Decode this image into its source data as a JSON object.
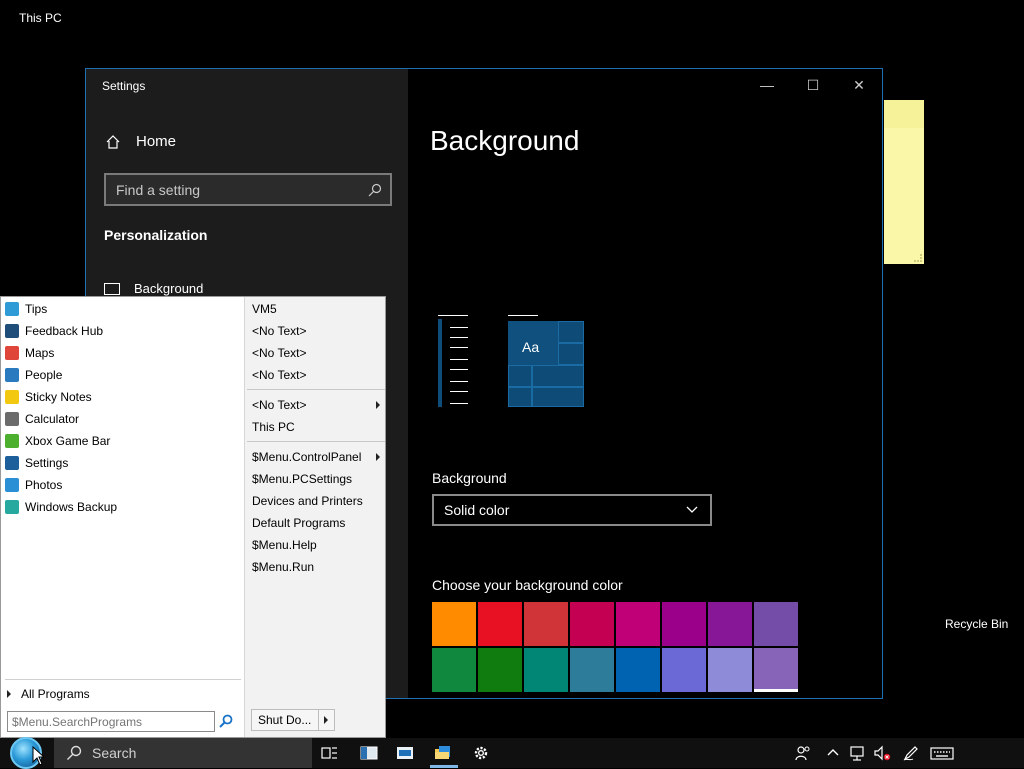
{
  "desktop": {
    "this_pc_label": "This PC",
    "recycle_bin_label": "Recycle Bin"
  },
  "settings_window": {
    "title": "Settings",
    "home_label": "Home",
    "search_placeholder": "Find a setting",
    "section_heading": "Personalization",
    "nav_item_background": "Background",
    "page_title": "Background",
    "preview_tile_text": "Aa",
    "background_field_label": "Background",
    "background_dropdown_value": "Solid color",
    "color_section_label": "Choose your background color",
    "window_controls": {
      "minimize": "—",
      "maximize": "☐",
      "close": "✕"
    },
    "swatch_colors": [
      "#ff8c00",
      "#e81123",
      "#d13438",
      "#c30052",
      "#bf0077",
      "#9a0089",
      "#881798",
      "#744da9",
      "#10893e",
      "#107c10",
      "#018574",
      "#2d7d9a",
      "#0063b1",
      "#6b69d6",
      "#8e8cd8",
      "#8764b8"
    ]
  },
  "start_menu": {
    "programs": [
      {
        "label": "Tips",
        "icon": "tips-icon",
        "color": "#2e9bd6"
      },
      {
        "label": "Feedback Hub",
        "icon": "feedback-hub-icon",
        "color": "#1e4e79"
      },
      {
        "label": "Maps",
        "icon": "maps-icon",
        "color": "#e0453a"
      },
      {
        "label": "People",
        "icon": "people-icon",
        "color": "#2a7ac0"
      },
      {
        "label": "Sticky Notes",
        "icon": "sticky-notes-icon",
        "color": "#f2c811"
      },
      {
        "label": "Calculator",
        "icon": "calculator-icon",
        "color": "#6b6b6b"
      },
      {
        "label": "Xbox Game Bar",
        "icon": "xbox-icon",
        "color": "#4caf2e"
      },
      {
        "label": "Settings",
        "icon": "settings-icon",
        "color": "#1c5f9a"
      },
      {
        "label": "Photos",
        "icon": "photos-icon",
        "color": "#2b8fd6"
      },
      {
        "label": "Windows Backup",
        "icon": "backup-icon",
        "color": "#28a9a0"
      }
    ],
    "all_programs_label": "All Programs",
    "search_placeholder": "$Menu.SearchPrograms",
    "places": [
      {
        "label": "VM5",
        "submenu": false
      },
      {
        "label": "<No Text>",
        "submenu": false
      },
      {
        "label": "<No Text>",
        "submenu": false
      },
      {
        "label": "<No Text>",
        "submenu": false
      },
      {
        "label": "<No Text>",
        "submenu": true
      },
      {
        "label": "This PC",
        "submenu": false
      },
      {
        "label": "$Menu.ControlPanel",
        "submenu": true
      },
      {
        "label": "$Menu.PCSettings",
        "submenu": false
      },
      {
        "label": "Devices and Printers",
        "submenu": false
      },
      {
        "label": "Default Programs",
        "submenu": false
      },
      {
        "label": "$Menu.Help",
        "submenu": false
      },
      {
        "label": "$Menu.Run",
        "submenu": false
      }
    ],
    "shutdown_label": "Shut Do..."
  },
  "taskbar": {
    "search_label": "Search",
    "pinned_icons": [
      "task-view-icon",
      "app-window-icon",
      "store-icon",
      "file-explorer-icon",
      "settings-icon"
    ],
    "tray_icons": [
      "people-icon",
      "chevron-up-icon",
      "network-icon",
      "volume-muted-icon",
      "pen-icon",
      "keyboard-icon"
    ]
  }
}
